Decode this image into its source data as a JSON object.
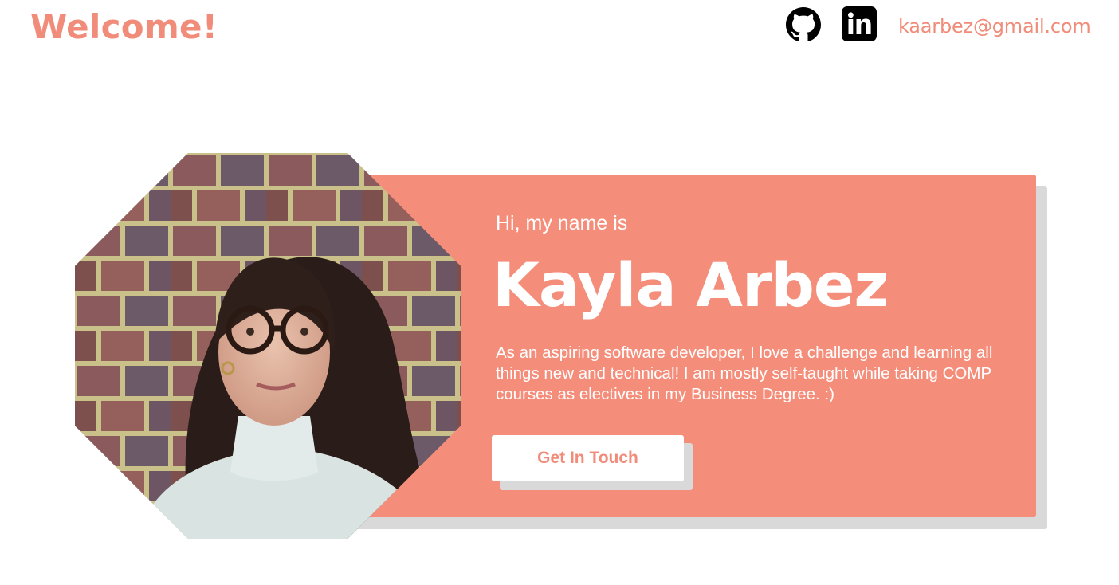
{
  "header": {
    "title": "Welcome!",
    "github_icon": "github-icon",
    "linkedin_icon": "linkedin-icon",
    "email": "kaarbez@gmail.com"
  },
  "hero": {
    "greeting": "Hi, my name is",
    "name": "Kayla Arbez",
    "bio": "As an aspiring software developer, I love a challenge and learning all things new and technical! I am mostly self-taught while taking COMP courses as electives in my Business Degree. :)",
    "cta_label": "Get In Touch",
    "photo": "profile-photo"
  },
  "colors": {
    "accent": "#f48e7b",
    "accent_text": "#f08c79",
    "shadow": "#d9d9d9",
    "icon": "#000000",
    "text_on_accent": "#ffffff"
  }
}
